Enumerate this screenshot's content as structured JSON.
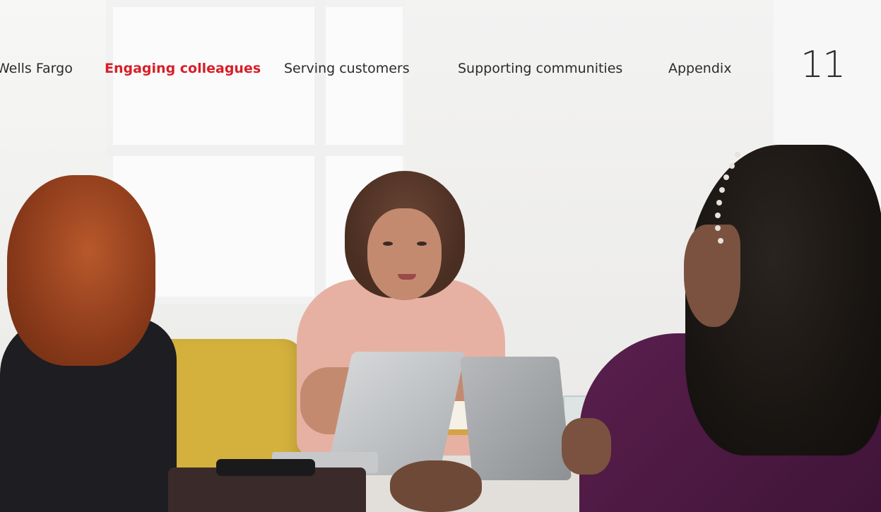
{
  "nav": {
    "items": [
      {
        "label": "Wells Fargo",
        "active": false
      },
      {
        "label": "Engaging colleagues",
        "active": true
      },
      {
        "label": "Serving customers",
        "active": false
      },
      {
        "label": "Supporting communities",
        "active": false
      },
      {
        "label": "Appendix",
        "active": false
      }
    ],
    "active_color": "#d71e28"
  },
  "page_number": "11",
  "image": {
    "description_icon": "meeting-photo"
  }
}
